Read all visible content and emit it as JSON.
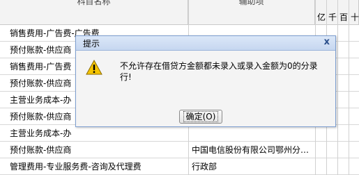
{
  "header": {
    "col1": "科目名称",
    "col2": "辅助项",
    "digits": [
      "亿",
      "千",
      "百",
      "十"
    ]
  },
  "rows": [
    {
      "account": "销售费用-广告费-广告费",
      "aux": ""
    },
    {
      "account": "预付账款-供应商",
      "aux": ""
    },
    {
      "account": "销售费用-广告费",
      "aux": ""
    },
    {
      "account": "预付账款-供应商",
      "aux": ""
    },
    {
      "account": "主营业务成本-办",
      "aux": ""
    },
    {
      "account": "预付账款-供应商",
      "aux": ""
    },
    {
      "account": "主营业务成本-办",
      "aux": ""
    },
    {
      "account": "预付账款-供应商",
      "aux": "中国电信股份有限公司鄂州分…"
    },
    {
      "account": "管理费用-专业服务费-咨询及代理费",
      "aux": "行政部"
    }
  ],
  "dialog": {
    "title": "提示",
    "close": "x",
    "message": "不允许存在借贷方金额都未录入或录入金额为0的分录行!",
    "ok_label": "确定(O)",
    "icon": "warning-icon"
  },
  "colors": {
    "dialog_border": "#7d9fd1",
    "title_bar": "#c6d7f0",
    "warning": "#f5c400"
  }
}
